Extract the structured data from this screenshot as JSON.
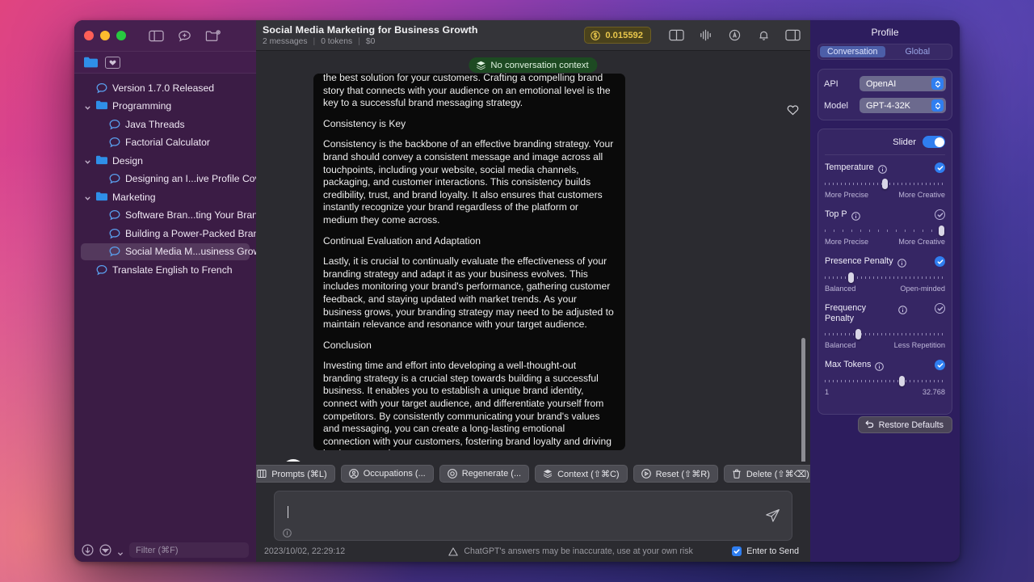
{
  "window": {
    "traffic_lights": [
      "close",
      "minimize",
      "maximize"
    ]
  },
  "sidebar": {
    "filter_placeholder": "Filter (⌘F)",
    "items": [
      {
        "label": "Version 1.7.0 Released",
        "type": "chat",
        "depth": 0,
        "selected": false
      },
      {
        "label": "Programming",
        "type": "folder",
        "depth": 0,
        "expanded": true,
        "selected": false
      },
      {
        "label": "Java Threads",
        "type": "chat",
        "depth": 1,
        "selected": false
      },
      {
        "label": "Factorial Calculator",
        "type": "chat",
        "depth": 1,
        "selected": false
      },
      {
        "label": "Design",
        "type": "folder",
        "depth": 0,
        "expanded": true,
        "selected": false
      },
      {
        "label": "Designing an I...ive Profile Cover",
        "type": "chat",
        "depth": 1,
        "selected": false
      },
      {
        "label": "Marketing",
        "type": "folder",
        "depth": 0,
        "expanded": true,
        "selected": false
      },
      {
        "label": "Software Bran...ting Your Brand",
        "type": "chat",
        "depth": 1,
        "selected": false
      },
      {
        "label": "Building a Power-Packed Brand",
        "type": "chat",
        "depth": 1,
        "selected": false
      },
      {
        "label": "Social Media M...usiness Growth",
        "type": "chat",
        "depth": 1,
        "selected": true
      },
      {
        "label": "Translate English to French",
        "type": "chat",
        "depth": 0,
        "selected": false
      }
    ]
  },
  "topbar": {
    "title": "Social Media Marketing for Business Growth",
    "messages": "2 messages",
    "tokens": "0 tokens",
    "cost": "$0",
    "cost_pill": "0.015592",
    "icons": [
      "split-view-icon",
      "waveform-icon",
      "accessibility-icon",
      "bell-icon",
      "right-panel-icon"
    ]
  },
  "chat": {
    "context_badge": "No conversation context",
    "favorite_icon": "heart-icon",
    "avatar_icon": "waveform-avatar-icon",
    "message_paragraphs": [
      "the best solution for your customers. Crafting a compelling brand story that connects with your audience on an emotional level is the key to a successful brand messaging strategy.",
      "Consistency is Key",
      "Consistency is the backbone of an effective branding strategy. Your brand should convey a consistent message and image across all touchpoints, including your website, social media channels, packaging, and customer interactions. This consistency builds credibility, trust, and brand loyalty. It also ensures that customers instantly recognize your brand regardless of the platform or medium they come across.",
      "Continual Evaluation and Adaptation",
      "Lastly, it is crucial to continually evaluate the effectiveness of your branding strategy and adapt it as your business evolves. This includes monitoring your brand's performance, gathering customer feedback, and staying updated with market trends. As your business grows, your branding strategy may need to be adjusted to maintain relevance and resonance with your target audience.",
      "Conclusion",
      "Investing time and effort into developing a well-thought-out branding strategy is a crucial step towards building a successful business. It enables you to establish a unique brand identity, connect with your target audience, and differentiate yourself from competitors. By consistently communicating your brand's values and messaging, you can create a long-lasting emotional connection with your customers, fostering brand loyalty and driving business growth."
    ]
  },
  "actions": [
    {
      "label": "Prompts (⌘L)",
      "icon": "book-icon"
    },
    {
      "label": "Occupations (...",
      "icon": "person-circle-icon"
    },
    {
      "label": "Regenerate (...",
      "icon": "refresh-circle-icon"
    },
    {
      "label": "Context (⇧⌘C)",
      "icon": "layers-icon"
    },
    {
      "label": "Reset (⇧⌘R)",
      "icon": "reset-circle-icon"
    },
    {
      "label": "Delete (⇧⌘⌫)",
      "icon": "trash-icon"
    }
  ],
  "composer": {
    "value": "",
    "placeholder": "",
    "send_icon": "send-icon",
    "info_icon": "info-icon"
  },
  "statusbar": {
    "timestamp": "2023/10/02, 22:29:12",
    "warning": "ChatGPT's answers may be inaccurate, use at your own risk",
    "enter_to_send": "Enter to Send",
    "enter_to_send_checked": true
  },
  "profile": {
    "title": "Profile",
    "tabs": [
      {
        "label": "Conversation",
        "active": true
      },
      {
        "label": "Global",
        "active": false
      }
    ],
    "api_label": "API",
    "api_value": "OpenAI",
    "model_label": "Model",
    "model_value": "GPT-4-32K",
    "slider_label": "Slider",
    "slider_enabled": true,
    "parameters": [
      {
        "name": "Temperature",
        "enabled": true,
        "thumb_percent": 50,
        "min_label": "More Precise",
        "max_label": "More Creative",
        "dense_ticks": true
      },
      {
        "name": "Top P",
        "enabled": false,
        "thumb_percent": 97,
        "min_label": "More Precise",
        "max_label": "More Creative",
        "dense_ticks": false
      },
      {
        "name": "Presence Penalty",
        "enabled": true,
        "thumb_percent": 22,
        "min_label": "Balanced",
        "max_label": "Open-minded",
        "dense_ticks": true
      },
      {
        "name": "Frequency Penalty",
        "enabled": false,
        "thumb_percent": 28,
        "min_label": "Balanced",
        "max_label": "Less Repetition",
        "dense_ticks": true
      },
      {
        "name": "Max Tokens",
        "enabled": true,
        "thumb_percent": 64,
        "min_label": "1",
        "max_label": "32.768",
        "dense_ticks": true
      }
    ],
    "restore_label": "Restore Defaults"
  },
  "colors": {
    "accent_blue": "#2f7ef0",
    "cost_yellow": "#e8c64b",
    "context_green": "#1d4a22",
    "sidebar_purple": "#3b1c45",
    "profile_purple": "#2d1d5e"
  }
}
